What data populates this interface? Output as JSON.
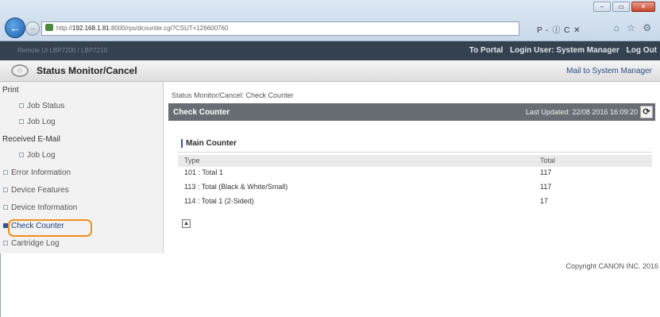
{
  "browser": {
    "url_prefix": "http://",
    "url_host": "192.168.1.81",
    "url_rest": ":8000/rps/dcounter.cgi?CSUT=126600760",
    "addr_tools": "P - ⓘ C ✕",
    "win_minimize": "–",
    "win_maximize": "▭",
    "win_close": "✕",
    "back_glyph": "←",
    "forward_glyph": "→",
    "tab_tools": "⌂ ☆ ⚙"
  },
  "topbar": {
    "device_name": "Remote UI          LBP7200 / LBP7210",
    "to_portal": "To Portal",
    "login_user": "Login User: System Manager",
    "logout": "Log Out"
  },
  "titlebar": {
    "title": "Status Monitor/Cancel",
    "mail_link": "Mail to System Manager"
  },
  "sidebar": {
    "items": [
      {
        "label": "Print",
        "kind": "sec"
      },
      {
        "label": "Job Status",
        "kind": "sub"
      },
      {
        "label": "Job Log",
        "kind": "sub"
      },
      {
        "label": "Received E-Mail",
        "kind": "sec"
      },
      {
        "label": "Job Log",
        "kind": "sub"
      },
      {
        "label": "Error Information",
        "kind": "item"
      },
      {
        "label": "Device Features",
        "kind": "item"
      },
      {
        "label": "Device Information",
        "kind": "item"
      },
      {
        "label": "Check Counter",
        "kind": "item",
        "active": true
      },
      {
        "label": "Cartridge Log",
        "kind": "item"
      }
    ]
  },
  "main": {
    "breadcrumb": "Status Monitor/Cancel: Check Counter",
    "panel_title": "Check Counter",
    "last_updated": "Last Updated: 22/08 2016 16:09:20",
    "refresh_glyph": "⟳",
    "section_title": "Main Counter",
    "columns": [
      "Type",
      "Total"
    ],
    "rows": [
      [
        "101 : Total 1",
        "117"
      ],
      [
        "113 : Total (Black & White/Small)",
        "117"
      ],
      [
        "114 : Total 1 (2-Sided)",
        "17"
      ]
    ],
    "top_glyph": "▲"
  },
  "footer": "Copyright CANON INC. 2016"
}
